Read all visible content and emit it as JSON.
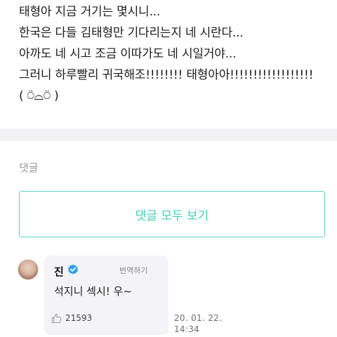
{
  "post": {
    "lines": [
      "태형아 지금 거기는 몇시니...",
      "한국은 다들 김태형만 기다리는지 네 시란다...",
      "아까도 네 시고 조금 이따가도 네 시일거야...",
      "그러니 하루빨리 귀국해조!!!!!!!! 태형아아!!!!!!!!!!!!!!!!!!",
      "( ⍥⌓⍥ )"
    ]
  },
  "comments": {
    "heading": "댓글",
    "view_all_label": "댓글 모두 보기",
    "items": [
      {
        "author": "진",
        "verified": true,
        "translate_label": "번역하기",
        "text": "석지니 섹시! 우~",
        "like_icon": "thumbs-up-icon",
        "likes": "21593",
        "date": "20. 01. 22.",
        "time": "14:34"
      }
    ]
  },
  "colors": {
    "accent": "#3fcfb4",
    "verified": "#2f9ce8",
    "divider_band": "#f3f3f5",
    "bubble_bg": "#f4f4f6"
  }
}
